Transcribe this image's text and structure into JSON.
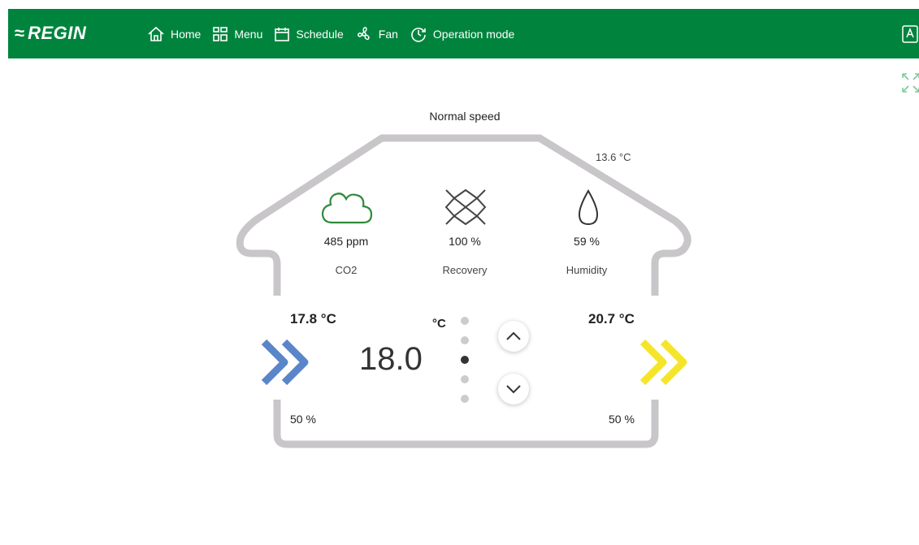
{
  "brand": {
    "name": "REGIN",
    "mark": "≈"
  },
  "nav": [
    {
      "label": "Home",
      "icon": "home-icon"
    },
    {
      "label": "Menu",
      "icon": "grid-icon"
    },
    {
      "label": "Schedule",
      "icon": "calendar-icon"
    },
    {
      "label": "Fan",
      "icon": "fan-icon"
    },
    {
      "label": "Operation mode",
      "icon": "clock-icon"
    }
  ],
  "colors": {
    "accent": "#00843d",
    "house_outline": "#c8c6c9",
    "supply_arrow": "#5a86c9",
    "exhaust_arrow": "#f5e52a",
    "co2_icon": "#2e8b3e"
  },
  "status": {
    "fan_speed": "Normal speed",
    "outdoor_temp": "13.6 °C"
  },
  "sensors": {
    "co2": {
      "value": "485 ppm",
      "label": "CO2",
      "icon": "cloud-icon"
    },
    "recovery": {
      "value": "100 %",
      "label": "Recovery",
      "icon": "heat-exchanger-icon"
    },
    "humidity": {
      "value": "59 %",
      "label": "Humidity",
      "icon": "droplet-icon"
    }
  },
  "left": {
    "temp": "17.8 °C",
    "percent": "50 %"
  },
  "right": {
    "temp": "20.7 °C",
    "percent": "50 %"
  },
  "setpoint": {
    "value": "18.0",
    "unit": "°C",
    "steps_total": 5,
    "active_step": 2
  }
}
